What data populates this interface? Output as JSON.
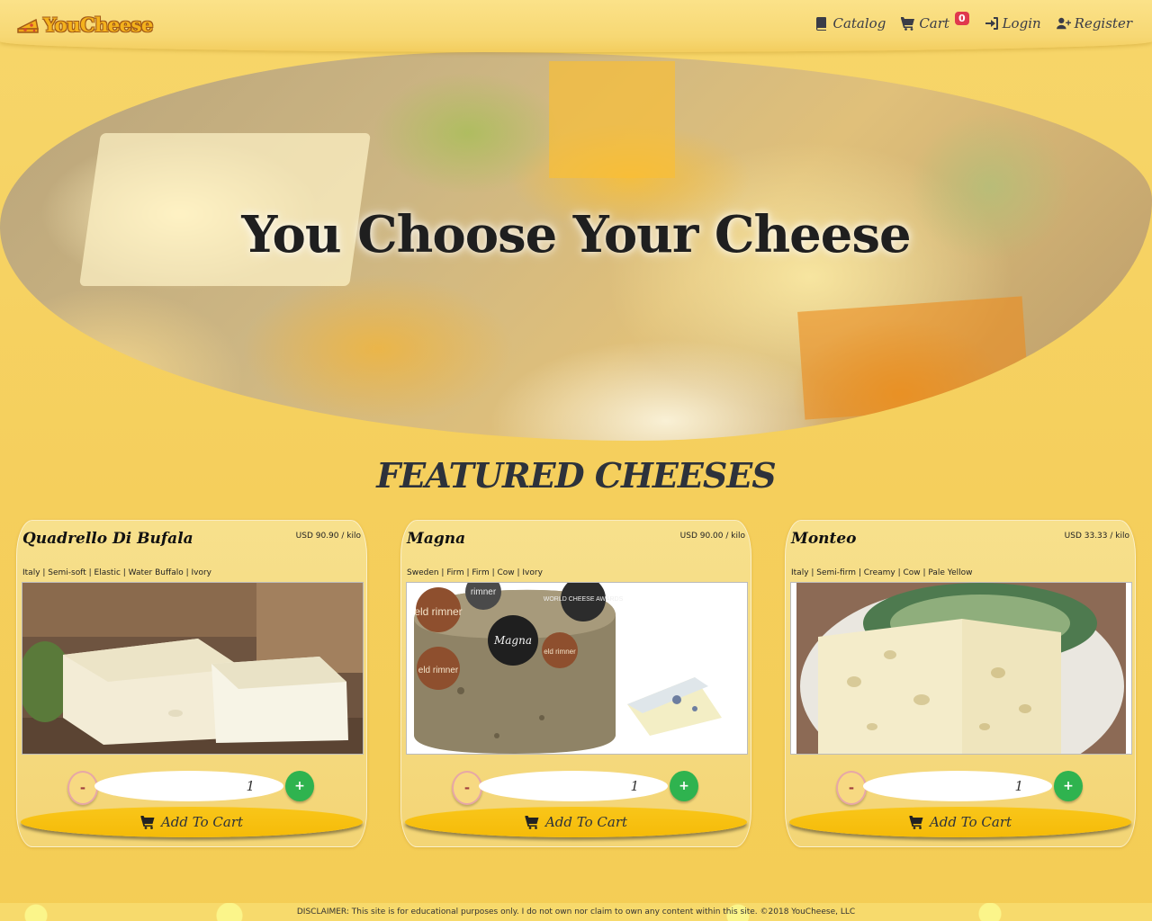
{
  "brand": {
    "name": "YouCheese",
    "logo_icon": "cheese-icon"
  },
  "nav": {
    "catalog": "Catalog",
    "cart": "Cart",
    "cart_count": "0",
    "login": "Login",
    "register": "Register"
  },
  "hero": {
    "title": "You Choose Your Cheese"
  },
  "featured": {
    "title": "FEATURED CHEESES"
  },
  "cards": [
    {
      "name": "Quadrello Di Bufala",
      "price": "USD 90.90 / kilo",
      "tags": "Italy | Semi-soft | Elastic | Water Buffalo | Ivory",
      "qty": "1",
      "minus": "-",
      "plus": "+",
      "add": "Add To Cart"
    },
    {
      "name": "Magna",
      "price": "USD 90.00 / kilo",
      "tags": "Sweden | Firm | Firm | Cow | Ivory",
      "qty": "1",
      "minus": "-",
      "plus": "+",
      "add": "Add To Cart",
      "badges": [
        "eld rimner",
        "WORLD CHEESE AWARDS",
        "Magna",
        "eld rimner",
        "eld rimner",
        "rimner"
      ]
    },
    {
      "name": "Monteo",
      "price": "USD 33.33 / kilo",
      "tags": "Italy | Semi-firm | Creamy | Cow | Pale Yellow",
      "qty": "1",
      "minus": "-",
      "plus": "+",
      "add": "Add To Cart"
    }
  ],
  "footer": {
    "disclaimer": "DISCLAIMER: This site is for educational purposes only. I do not own nor claim to own any content within this site. ©2018 YouCheese, LLC"
  },
  "colors": {
    "accent": "#f5bb08",
    "plus": "#2fb34f",
    "badge": "#e0394d",
    "text": "#2d323b"
  }
}
